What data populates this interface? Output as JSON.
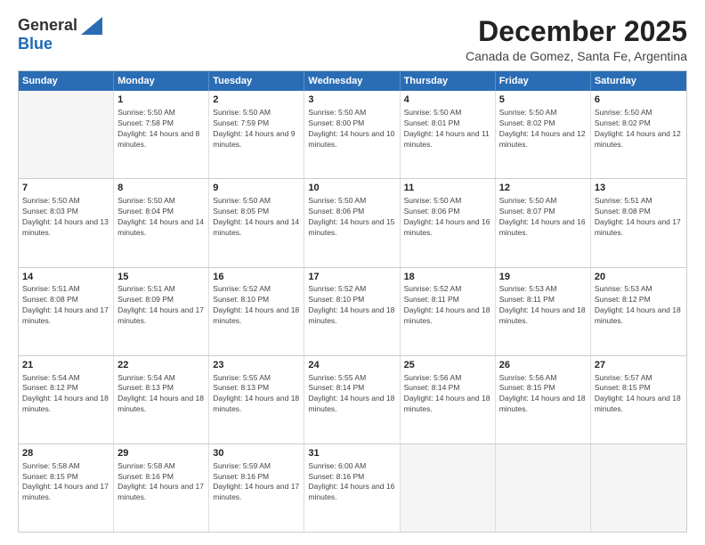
{
  "logo": {
    "general": "General",
    "blue": "Blue"
  },
  "header": {
    "month": "December 2025",
    "location": "Canada de Gomez, Santa Fe, Argentina"
  },
  "weekdays": [
    "Sunday",
    "Monday",
    "Tuesday",
    "Wednesday",
    "Thursday",
    "Friday",
    "Saturday"
  ],
  "rows": [
    [
      {
        "date": "",
        "sunrise": "",
        "sunset": "",
        "daylight": ""
      },
      {
        "date": "1",
        "sunrise": "Sunrise: 5:50 AM",
        "sunset": "Sunset: 7:58 PM",
        "daylight": "Daylight: 14 hours and 8 minutes."
      },
      {
        "date": "2",
        "sunrise": "Sunrise: 5:50 AM",
        "sunset": "Sunset: 7:59 PM",
        "daylight": "Daylight: 14 hours and 9 minutes."
      },
      {
        "date": "3",
        "sunrise": "Sunrise: 5:50 AM",
        "sunset": "Sunset: 8:00 PM",
        "daylight": "Daylight: 14 hours and 10 minutes."
      },
      {
        "date": "4",
        "sunrise": "Sunrise: 5:50 AM",
        "sunset": "Sunset: 8:01 PM",
        "daylight": "Daylight: 14 hours and 11 minutes."
      },
      {
        "date": "5",
        "sunrise": "Sunrise: 5:50 AM",
        "sunset": "Sunset: 8:02 PM",
        "daylight": "Daylight: 14 hours and 12 minutes."
      },
      {
        "date": "6",
        "sunrise": "Sunrise: 5:50 AM",
        "sunset": "Sunset: 8:02 PM",
        "daylight": "Daylight: 14 hours and 12 minutes."
      }
    ],
    [
      {
        "date": "7",
        "sunrise": "Sunrise: 5:50 AM",
        "sunset": "Sunset: 8:03 PM",
        "daylight": "Daylight: 14 hours and 13 minutes."
      },
      {
        "date": "8",
        "sunrise": "Sunrise: 5:50 AM",
        "sunset": "Sunset: 8:04 PM",
        "daylight": "Daylight: 14 hours and 14 minutes."
      },
      {
        "date": "9",
        "sunrise": "Sunrise: 5:50 AM",
        "sunset": "Sunset: 8:05 PM",
        "daylight": "Daylight: 14 hours and 14 minutes."
      },
      {
        "date": "10",
        "sunrise": "Sunrise: 5:50 AM",
        "sunset": "Sunset: 8:06 PM",
        "daylight": "Daylight: 14 hours and 15 minutes."
      },
      {
        "date": "11",
        "sunrise": "Sunrise: 5:50 AM",
        "sunset": "Sunset: 8:06 PM",
        "daylight": "Daylight: 14 hours and 16 minutes."
      },
      {
        "date": "12",
        "sunrise": "Sunrise: 5:50 AM",
        "sunset": "Sunset: 8:07 PM",
        "daylight": "Daylight: 14 hours and 16 minutes."
      },
      {
        "date": "13",
        "sunrise": "Sunrise: 5:51 AM",
        "sunset": "Sunset: 8:08 PM",
        "daylight": "Daylight: 14 hours and 17 minutes."
      }
    ],
    [
      {
        "date": "14",
        "sunrise": "Sunrise: 5:51 AM",
        "sunset": "Sunset: 8:08 PM",
        "daylight": "Daylight: 14 hours and 17 minutes."
      },
      {
        "date": "15",
        "sunrise": "Sunrise: 5:51 AM",
        "sunset": "Sunset: 8:09 PM",
        "daylight": "Daylight: 14 hours and 17 minutes."
      },
      {
        "date": "16",
        "sunrise": "Sunrise: 5:52 AM",
        "sunset": "Sunset: 8:10 PM",
        "daylight": "Daylight: 14 hours and 18 minutes."
      },
      {
        "date": "17",
        "sunrise": "Sunrise: 5:52 AM",
        "sunset": "Sunset: 8:10 PM",
        "daylight": "Daylight: 14 hours and 18 minutes."
      },
      {
        "date": "18",
        "sunrise": "Sunrise: 5:52 AM",
        "sunset": "Sunset: 8:11 PM",
        "daylight": "Daylight: 14 hours and 18 minutes."
      },
      {
        "date": "19",
        "sunrise": "Sunrise: 5:53 AM",
        "sunset": "Sunset: 8:11 PM",
        "daylight": "Daylight: 14 hours and 18 minutes."
      },
      {
        "date": "20",
        "sunrise": "Sunrise: 5:53 AM",
        "sunset": "Sunset: 8:12 PM",
        "daylight": "Daylight: 14 hours and 18 minutes."
      }
    ],
    [
      {
        "date": "21",
        "sunrise": "Sunrise: 5:54 AM",
        "sunset": "Sunset: 8:12 PM",
        "daylight": "Daylight: 14 hours and 18 minutes."
      },
      {
        "date": "22",
        "sunrise": "Sunrise: 5:54 AM",
        "sunset": "Sunset: 8:13 PM",
        "daylight": "Daylight: 14 hours and 18 minutes."
      },
      {
        "date": "23",
        "sunrise": "Sunrise: 5:55 AM",
        "sunset": "Sunset: 8:13 PM",
        "daylight": "Daylight: 14 hours and 18 minutes."
      },
      {
        "date": "24",
        "sunrise": "Sunrise: 5:55 AM",
        "sunset": "Sunset: 8:14 PM",
        "daylight": "Daylight: 14 hours and 18 minutes."
      },
      {
        "date": "25",
        "sunrise": "Sunrise: 5:56 AM",
        "sunset": "Sunset: 8:14 PM",
        "daylight": "Daylight: 14 hours and 18 minutes."
      },
      {
        "date": "26",
        "sunrise": "Sunrise: 5:56 AM",
        "sunset": "Sunset: 8:15 PM",
        "daylight": "Daylight: 14 hours and 18 minutes."
      },
      {
        "date": "27",
        "sunrise": "Sunrise: 5:57 AM",
        "sunset": "Sunset: 8:15 PM",
        "daylight": "Daylight: 14 hours and 18 minutes."
      }
    ],
    [
      {
        "date": "28",
        "sunrise": "Sunrise: 5:58 AM",
        "sunset": "Sunset: 8:15 PM",
        "daylight": "Daylight: 14 hours and 17 minutes."
      },
      {
        "date": "29",
        "sunrise": "Sunrise: 5:58 AM",
        "sunset": "Sunset: 8:16 PM",
        "daylight": "Daylight: 14 hours and 17 minutes."
      },
      {
        "date": "30",
        "sunrise": "Sunrise: 5:59 AM",
        "sunset": "Sunset: 8:16 PM",
        "daylight": "Daylight: 14 hours and 17 minutes."
      },
      {
        "date": "31",
        "sunrise": "Sunrise: 6:00 AM",
        "sunset": "Sunset: 8:16 PM",
        "daylight": "Daylight: 14 hours and 16 minutes."
      },
      {
        "date": "",
        "sunrise": "",
        "sunset": "",
        "daylight": ""
      },
      {
        "date": "",
        "sunrise": "",
        "sunset": "",
        "daylight": ""
      },
      {
        "date": "",
        "sunrise": "",
        "sunset": "",
        "daylight": ""
      }
    ]
  ]
}
